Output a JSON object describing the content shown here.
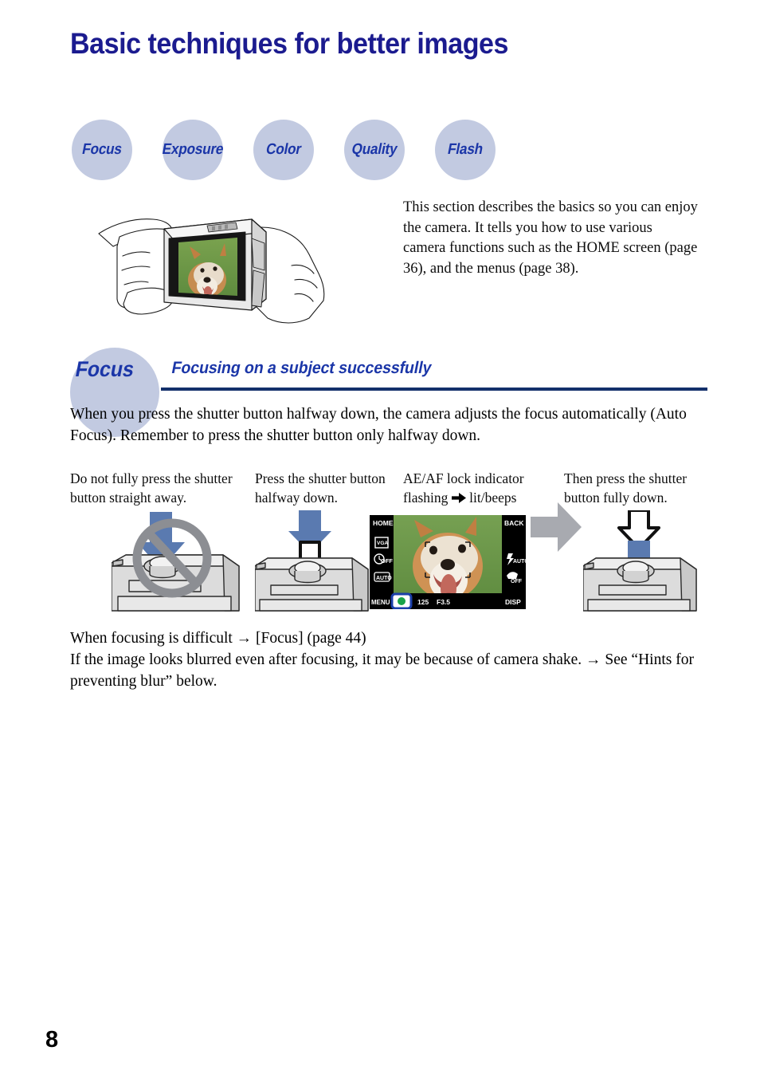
{
  "page": {
    "title": "Basic techniques for better images",
    "number": "8",
    "title_color": "#1b1b8f"
  },
  "colors": {
    "badge_fill": "#c2cae1",
    "badge_text": "#1b36a8",
    "rule": "#13306b",
    "arrow_blue": "#5a7ab0",
    "arrow_grey": "#a8aab0",
    "prohibit_grey": "#8c8e93",
    "lcd_green": "#6e9b4a",
    "lcd_bar": "#000000"
  },
  "badges": [
    {
      "label": "Focus"
    },
    {
      "label": "Exposure"
    },
    {
      "label": "Color"
    },
    {
      "label": "Quality"
    },
    {
      "label": "Flash"
    }
  ],
  "intro": {
    "text": "This section describes the basics so you can enjoy the camera. It tells you how to use various camera functions such as the HOME screen (page 36), and the menus (page 38)."
  },
  "illustration": {
    "hand_camera_name": "hands-holding-camera-illustration",
    "lcd_subject": "dog-photo"
  },
  "section": {
    "badge_label": "Focus",
    "title": "Focusing on a subject successfully",
    "paragraph": "When you press the shutter button halfway down, the camera adjusts the focus automatically (Auto Focus). Remember to press the shutter button only halfway down."
  },
  "steps": [
    {
      "caption": "Do not fully press the shutter button straight away.",
      "figure": "camera-shutter-prohibited"
    },
    {
      "caption": "Press the shutter button halfway down.",
      "figure": "camera-shutter-halfway"
    },
    {
      "caption_line1": "AE/AF lock indicator",
      "caption_line2_before": "flashing",
      "caption_line2_after": "lit/beeps",
      "figure": "lcd-screen-ae-af-lock"
    },
    {
      "caption": "Then press the shutter button fully down.",
      "figure": "camera-shutter-full"
    }
  ],
  "lcd": {
    "home_label": "HOME",
    "back_label": "BACK",
    "menu_label": "MENU",
    "disp_label": "DISP",
    "image_size": "VGA",
    "self_timer": "OFF",
    "iso": "AUTO",
    "flash_mode": "AUTO",
    "macro_mode": "OFF",
    "shutter_speed": "125",
    "aperture": "F3.5",
    "ae_af_indicator": "ae-af-lock-dot"
  },
  "notes": {
    "line1": "When focusing is difficult → [Focus] (page 44)",
    "line2": "If the image looks blurred even after focusing, it may be because of camera shake. → See “Hints for preventing blur” below."
  }
}
